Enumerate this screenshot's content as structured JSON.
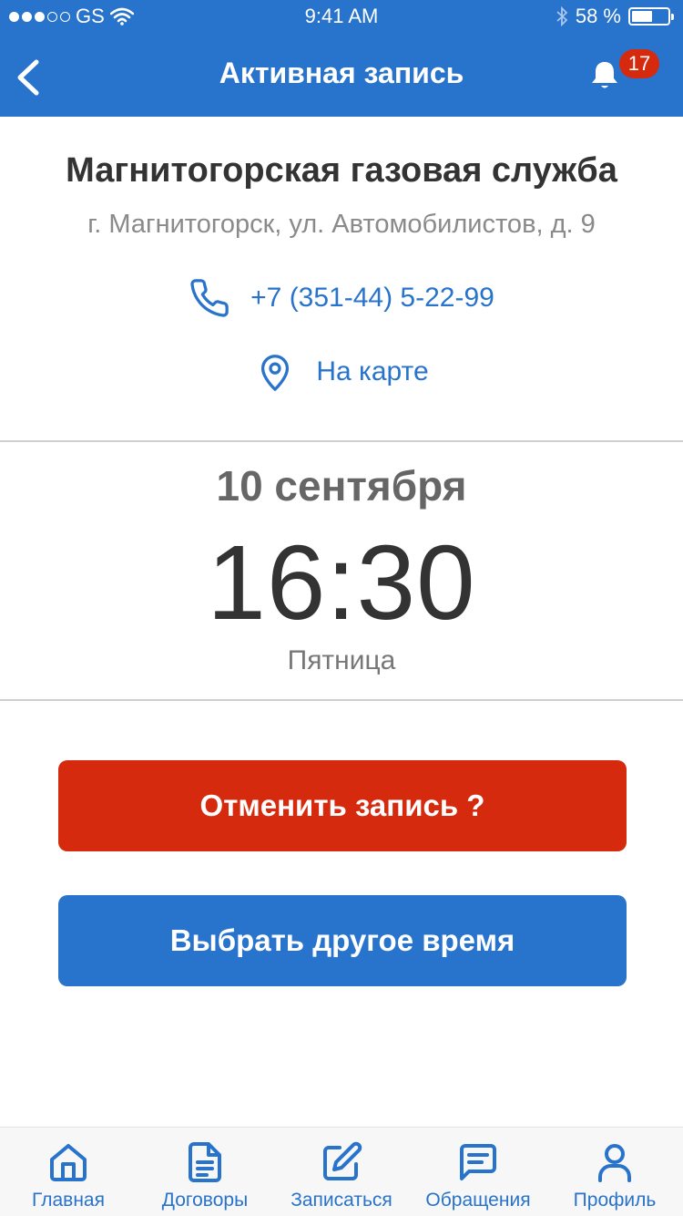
{
  "status_bar": {
    "carrier": "GS",
    "time": "9:41 AM",
    "battery_text": "58 %",
    "battery_level": 0.58,
    "signal_bars_filled": 3,
    "signal_bars_total": 5
  },
  "header": {
    "title": "Активная запись",
    "notification_count": "17",
    "back_icon": "chevron-left-icon",
    "bell_icon": "bell-icon"
  },
  "organization": {
    "name": "Магнитогорская газовая служба",
    "address": "г. Магнитогорск, ул. Автомобилистов, д. 9",
    "phone": "+7 (351-44) 5-22-99",
    "map_link": "На карте"
  },
  "appointment": {
    "date": "10 сентября",
    "time": "16:30",
    "weekday": "Пятница"
  },
  "actions": {
    "cancel_label": "Отменить запись ?",
    "reschedule_label": "Выбрать другое время"
  },
  "tabbar": {
    "items": [
      {
        "label": "Главная",
        "icon": "home-icon"
      },
      {
        "label": "Договоры",
        "icon": "document-icon"
      },
      {
        "label": "Записаться",
        "icon": "edit-icon"
      },
      {
        "label": "Обращения",
        "icon": "chat-icon"
      },
      {
        "label": "Профиль",
        "icon": "user-icon"
      }
    ]
  },
  "colors": {
    "primary": "#2873cb",
    "danger": "#d62a0f",
    "text_dark": "#333333",
    "text_muted": "#8a8a8a",
    "divider": "#cfcfcf"
  }
}
